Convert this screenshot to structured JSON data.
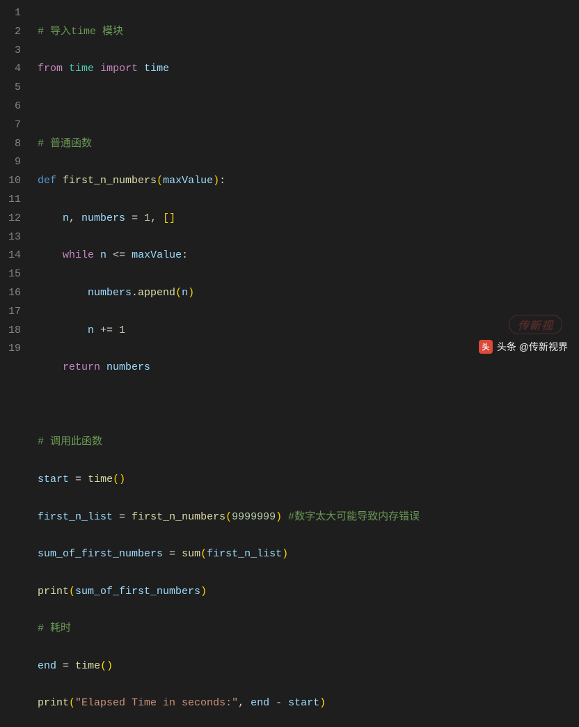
{
  "gutter": {
    "lines": [
      "1",
      "2",
      "3",
      "4",
      "5",
      "6",
      "7",
      "8",
      "9",
      "10",
      "11",
      "12",
      "13",
      "14",
      "15",
      "16",
      "17",
      "18",
      "19"
    ]
  },
  "code": {
    "l1": {
      "c1": "# 导入time 模块"
    },
    "l2": {
      "k1": "from",
      "m1": "time",
      "k2": "import",
      "n1": "time"
    },
    "l4": {
      "c1": "# 普通函数"
    },
    "l5": {
      "k1": "def",
      "fn": "first_n_numbers",
      "p1": "maxValue"
    },
    "l6": {
      "v1": "n",
      "v2": "numbers",
      "n1": "1"
    },
    "l7": {
      "k1": "while",
      "v1": "n",
      "v2": "maxValue"
    },
    "l8": {
      "v1": "numbers",
      "m1": "append",
      "v2": "n"
    },
    "l9": {
      "v1": "n",
      "n1": "1"
    },
    "l10": {
      "k1": "return",
      "v1": "numbers"
    },
    "l12": {
      "c1": "# 调用此函数"
    },
    "l13": {
      "v1": "start",
      "fn": "time"
    },
    "l14": {
      "v1": "first_n_list",
      "fn": "first_n_numbers",
      "n1": "9999999",
      "c1": "#数字太大可能导致内存错误"
    },
    "l15": {
      "v1": "sum_of_first_numbers",
      "fn": "sum",
      "a1": "first_n_list"
    },
    "l16": {
      "fn": "print",
      "a1": "sum_of_first_numbers"
    },
    "l17": {
      "c1": "# 耗时"
    },
    "l18": {
      "v1": "end",
      "fn": "time"
    },
    "l19": {
      "fn": "print",
      "s1": "\"Elapsed Time in seconds:\"",
      "v1": "end",
      "v2": "start"
    }
  },
  "watermark": {
    "brand_pill": "传新视",
    "brand_line": "头条 @传新视界",
    "badge_char": "头"
  }
}
